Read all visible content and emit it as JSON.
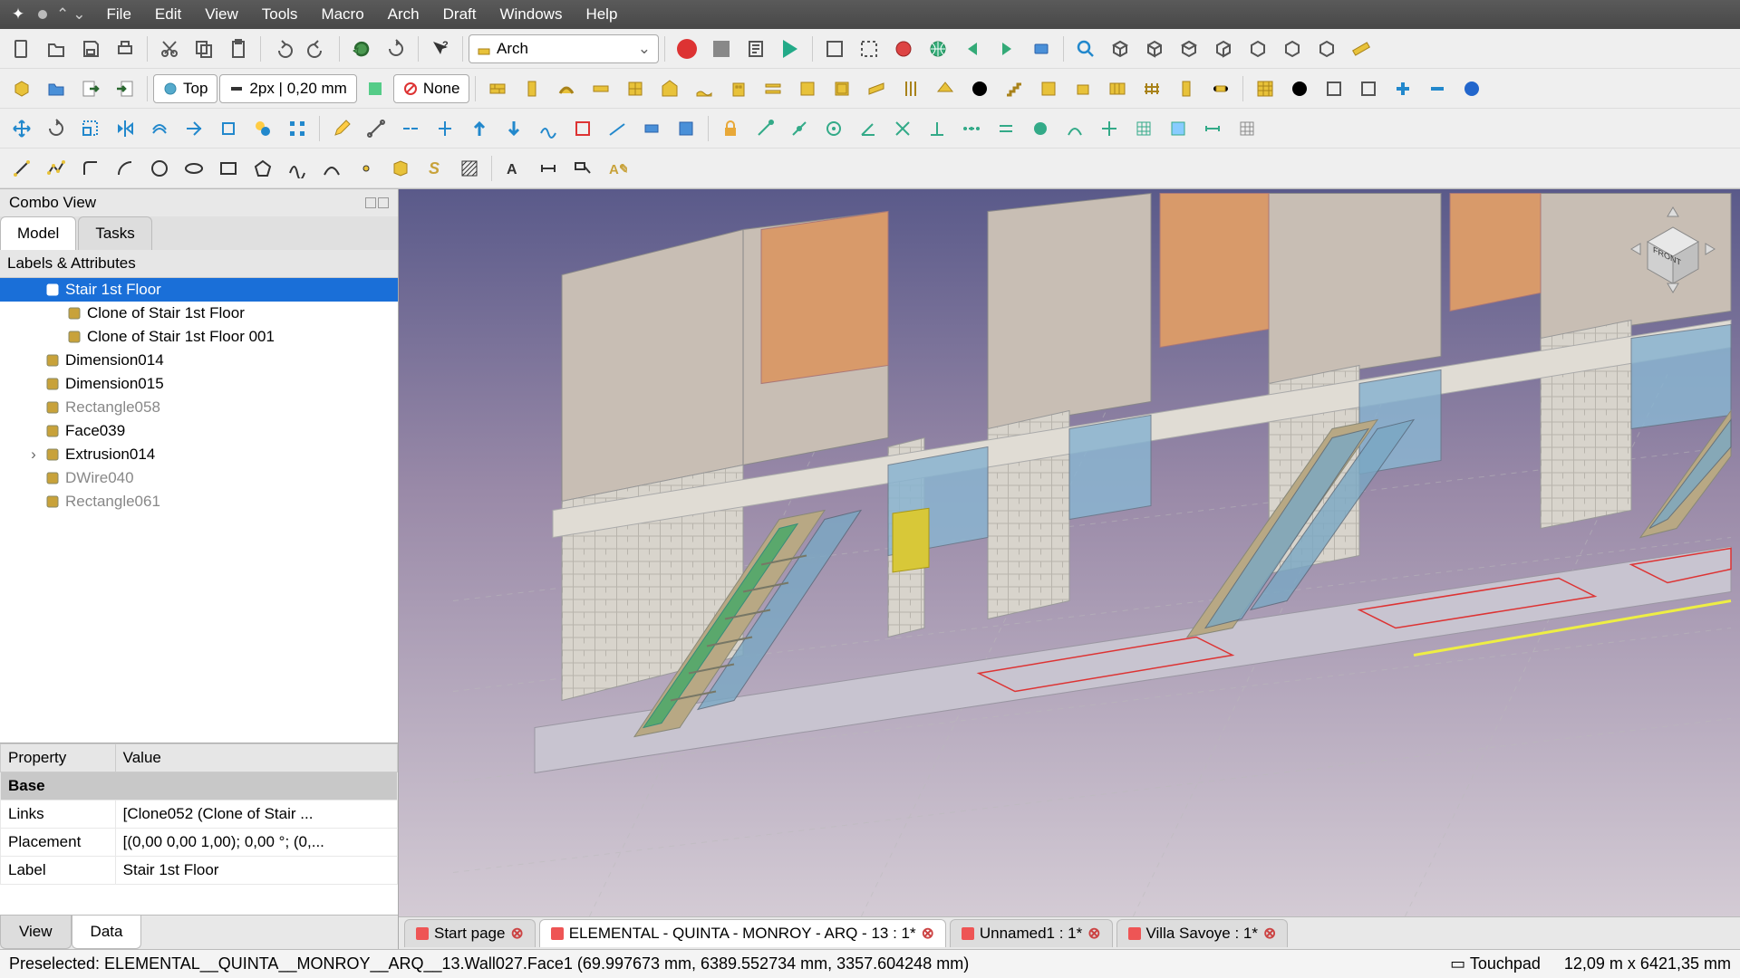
{
  "menu": {
    "items": [
      "File",
      "Edit",
      "View",
      "Tools",
      "Macro",
      "Arch",
      "Draft",
      "Windows",
      "Help"
    ]
  },
  "workbench": {
    "name": "Arch"
  },
  "view_preset": {
    "label": "Top"
  },
  "line_style": {
    "label": "2px | 0,20 mm"
  },
  "auto_group": {
    "label": "None"
  },
  "combo": {
    "title": "Combo View",
    "tabs": {
      "model": "Model",
      "tasks": "Tasks"
    },
    "tree_header": "Labels & Attributes",
    "nodes": [
      {
        "label": "Stair 1st Floor",
        "depth": 1,
        "selected": true,
        "expander": "",
        "dim": false
      },
      {
        "label": "Clone of Stair 1st Floor",
        "depth": 2,
        "selected": false,
        "expander": "",
        "dim": false
      },
      {
        "label": "Clone of Stair 1st Floor 001",
        "depth": 2,
        "selected": false,
        "expander": "",
        "dim": false
      },
      {
        "label": "Dimension014",
        "depth": 1,
        "selected": false,
        "expander": "",
        "dim": false
      },
      {
        "label": "Dimension015",
        "depth": 1,
        "selected": false,
        "expander": "",
        "dim": false
      },
      {
        "label": "Rectangle058",
        "depth": 1,
        "selected": false,
        "expander": "",
        "dim": true
      },
      {
        "label": "Face039",
        "depth": 1,
        "selected": false,
        "expander": "",
        "dim": false
      },
      {
        "label": "Extrusion014",
        "depth": 1,
        "selected": false,
        "expander": "›",
        "dim": false
      },
      {
        "label": "DWire040",
        "depth": 1,
        "selected": false,
        "expander": "",
        "dim": true
      },
      {
        "label": "Rectangle061",
        "depth": 1,
        "selected": false,
        "expander": "",
        "dim": true
      }
    ],
    "prop_headers": {
      "property": "Property",
      "value": "Value"
    },
    "prop_section": "Base",
    "props": [
      {
        "name": "Links",
        "value": "[Clone052 (Clone of Stair ..."
      },
      {
        "name": "Placement",
        "value": "[(0,00 0,00 1,00); 0,00 °; (0,..."
      },
      {
        "name": "Label",
        "value": "Stair 1st Floor"
      }
    ],
    "bottom_tabs": {
      "view": "View",
      "data": "Data"
    }
  },
  "doc_tabs": [
    {
      "label": "Start page",
      "active": false
    },
    {
      "label": "ELEMENTAL - QUINTA - MONROY - ARQ - 13 : 1*",
      "active": true
    },
    {
      "label": "Unnamed1 : 1*",
      "active": false
    },
    {
      "label": "Villa Savoye : 1*",
      "active": false
    }
  ],
  "status": {
    "message": "Preselected: ELEMENTAL__QUINTA__MONROY__ARQ__13.Wall027.Face1 (69.997673 mm, 6389.552734 mm, 3357.604248 mm)",
    "nav_style": "Touchpad",
    "dimensions": "12,09 m x 6421,35 mm"
  },
  "navcube": {
    "face": "FRONT"
  }
}
